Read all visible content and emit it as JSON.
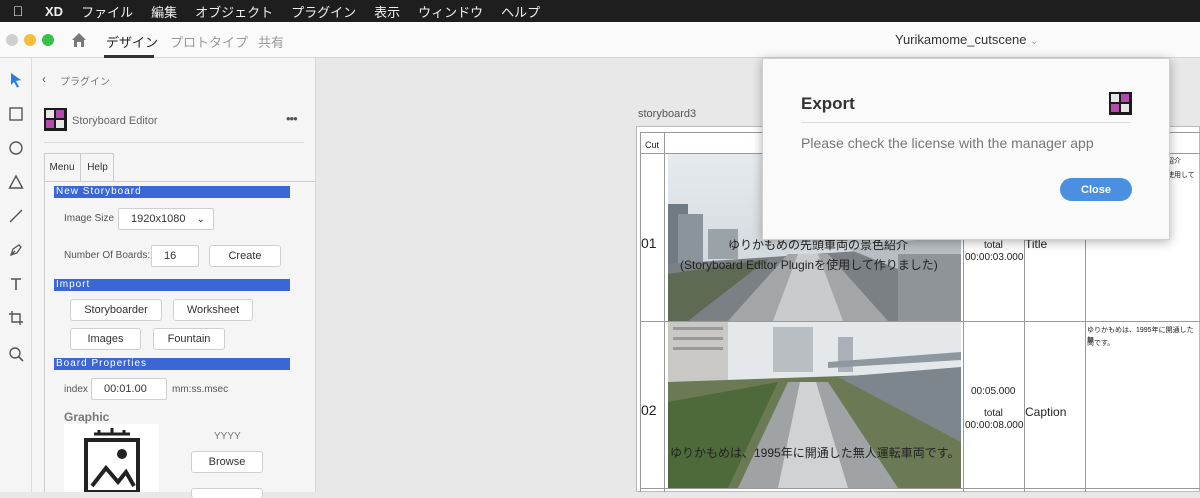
{
  "menubar": {
    "app": "XD",
    "items": [
      "ファイル",
      "編集",
      "オブジェクト",
      "プラグイン",
      "表示",
      "ウィンドウ",
      "ヘルプ"
    ]
  },
  "titlebar": {
    "tabs": [
      "デザイン",
      "プロトタイプ",
      "共有"
    ],
    "document_title": "Yurikamome_cutscene"
  },
  "toolbar": {
    "tools": [
      "select-tool-icon",
      "rectangle-tool-icon",
      "ellipse-tool-icon",
      "polygon-tool-icon",
      "line-tool-icon",
      "pen-tool-icon",
      "text-tool-icon",
      "artboard-tool-icon",
      "zoom-tool-icon"
    ]
  },
  "plugin_panel": {
    "back_label": "プラグイン",
    "plugin_name": "Storyboard Editor",
    "more": "•••",
    "tabs": [
      "Menu",
      "Help"
    ],
    "new_storyboard": {
      "header": "New Storyboard",
      "image_size_label": "Image Size",
      "image_size_value": "1920x1080",
      "boards_label": "Number Of Boards:",
      "boards_value": "16",
      "create": "Create"
    },
    "import": {
      "header": "Import",
      "buttons": [
        "Storyboarder",
        "Worksheet",
        "Images",
        "Fountain"
      ]
    },
    "board_properties": {
      "header": "Board Properties",
      "index_label": "index",
      "index_value": "00:01.00",
      "format_label": "mm:ss.msec",
      "graphic_label": "Graphic",
      "yyyy": "YYYY",
      "browse": "Browse"
    }
  },
  "storyboard": {
    "artboard_name": "storyboard3",
    "cut_header": "Cut",
    "rows": [
      {
        "cut": "01",
        "overlay_line1": "ゆりかもめの先頭車両の景色紹介",
        "overlay_line2": "(Storyboard Editor Pluginを使用して作りました)",
        "duration": "",
        "total_label": "total",
        "total": "00:00:03.000",
        "type": "Title",
        "note_line1": "り紹介",
        "note_line2": "を使用して"
      },
      {
        "cut": "02",
        "overlay_line1": "ゆりかもめは、1995年に開通した無人運転車両です。",
        "duration": "00:05.000",
        "total_label": "total",
        "total": "00:00:08.000",
        "type": "Caption",
        "note_line1": "ゆりかもめは、1995年に開通した無",
        "note_line2": "両です。"
      }
    ]
  },
  "dialog": {
    "title": "Export",
    "message": "Please check the license with the manager app",
    "close": "Close"
  },
  "colors": {
    "accent": "#3b67d6",
    "close_button": "#4a8fe0",
    "menubar": "#1e1e1e"
  }
}
